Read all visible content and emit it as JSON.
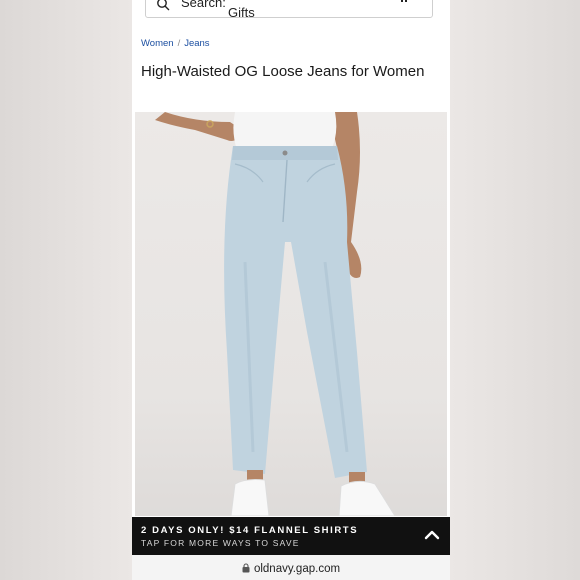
{
  "search": {
    "label": "Search:",
    "value": "Gifts"
  },
  "breadcrumb": {
    "items": [
      "Women",
      "Jeans"
    ],
    "separator": "/"
  },
  "product": {
    "title": "High-Waisted OG Loose Jeans for Women"
  },
  "promo": {
    "headline": "2 DAYS ONLY! $14 FLANNEL SHIRTS",
    "subline": "TAP FOR MORE WAYS TO SAVE"
  },
  "browser": {
    "url": "oldnavy.gap.com"
  },
  "icons": [
    "search-icon",
    "pause-icon",
    "chevron-up-icon",
    "lock-icon"
  ],
  "colors": {
    "link": "#1c4fa1",
    "promo_bg": "#111111",
    "denim": "#bcd0dc"
  }
}
